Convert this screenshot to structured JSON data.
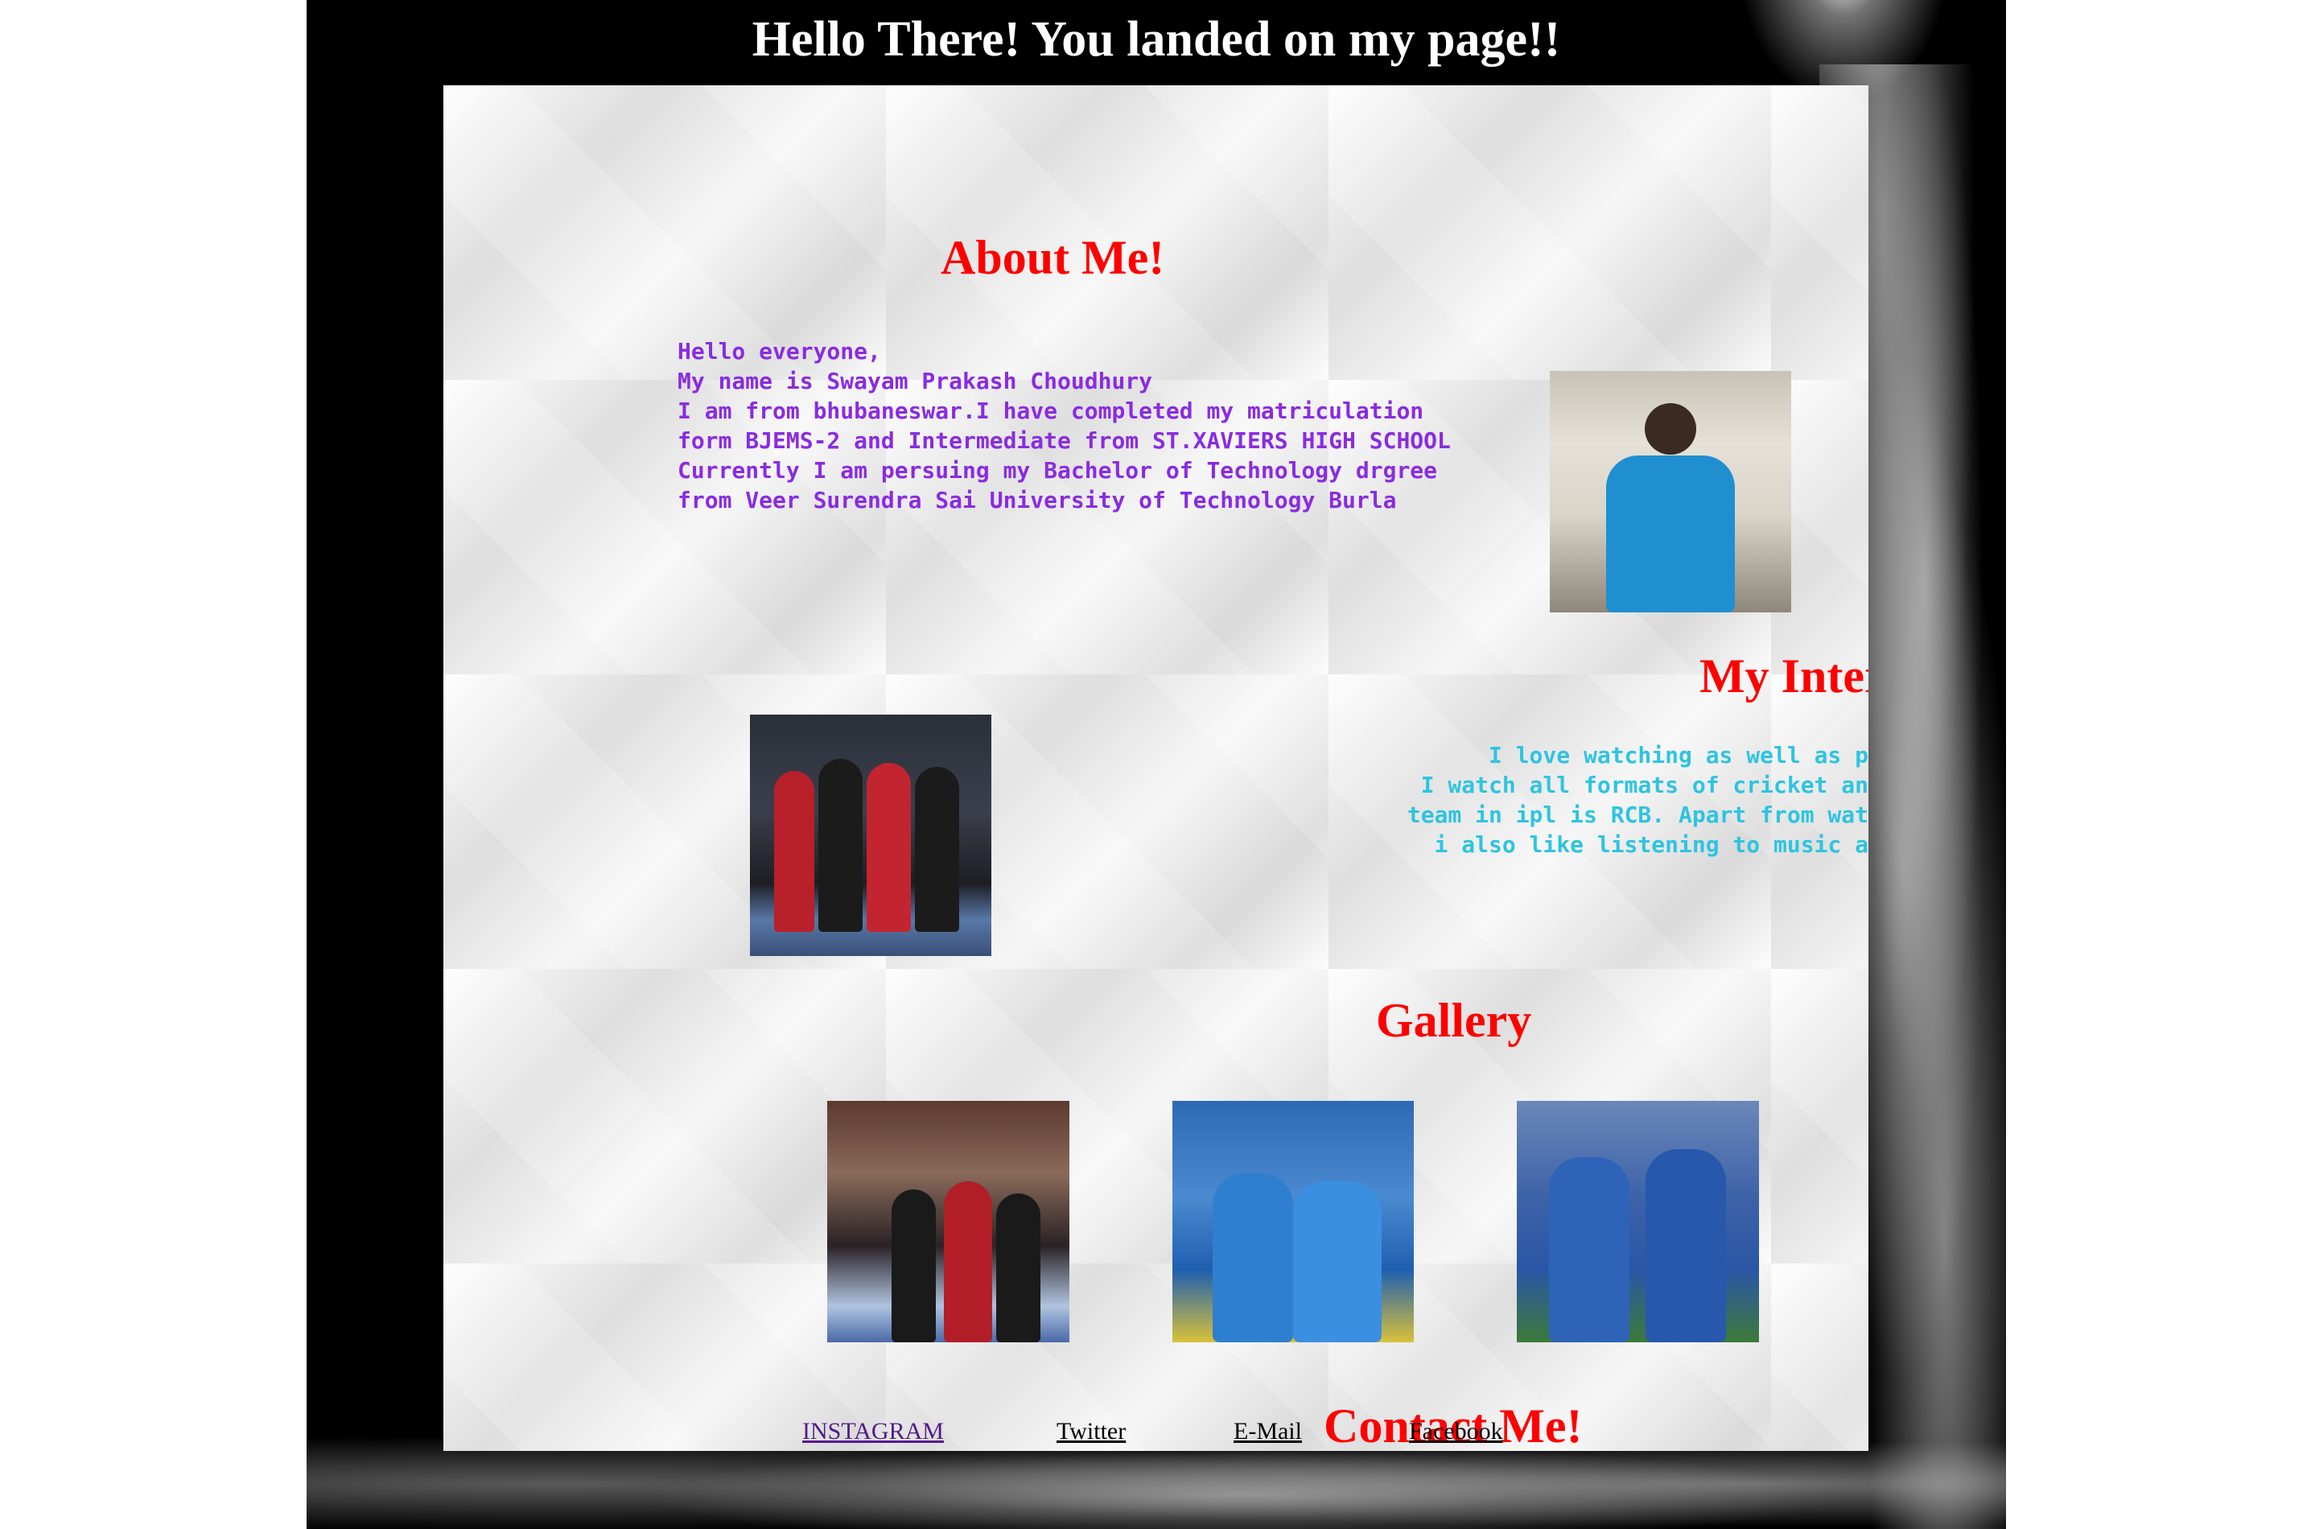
{
  "header": {
    "title": "Hello There! You landed on my page!!"
  },
  "about": {
    "heading": "About Me!",
    "text": "Hello everyone,\nMy name is Swayam Prakash Choudhury\nI am from bhubaneswar.I have completed my matriculation\nform BJEMS-2 and Intermediate from ST.XAVIERS HIGH SCHOOL\nCurrently I am persuing my Bachelor of Technology drgree\nfrom Veer Surendra Sai University of Technology Burla"
  },
  "interests": {
    "heading": "My Interests !",
    "text": "I love watching as well as playing cricket\nI watch all formats of cricket and my favourite\nteam in ipl is RCB. Apart from watching cricket \ni also like listening to music and travelling."
  },
  "gallery": {
    "heading": "Gallery"
  },
  "contact": {
    "heading": "Contact Me!",
    "links": [
      "INSTAGRAM",
      "Twitter",
      "E-Mail",
      "Facebook"
    ]
  },
  "colors": {
    "heading": "#ff0000",
    "about_text": "#8a2be2",
    "interests_text": "#2ec4e0",
    "visited_link": "#551a8b",
    "background": "#000000"
  },
  "icons": [
    "spotlight-beam",
    "smoke"
  ]
}
